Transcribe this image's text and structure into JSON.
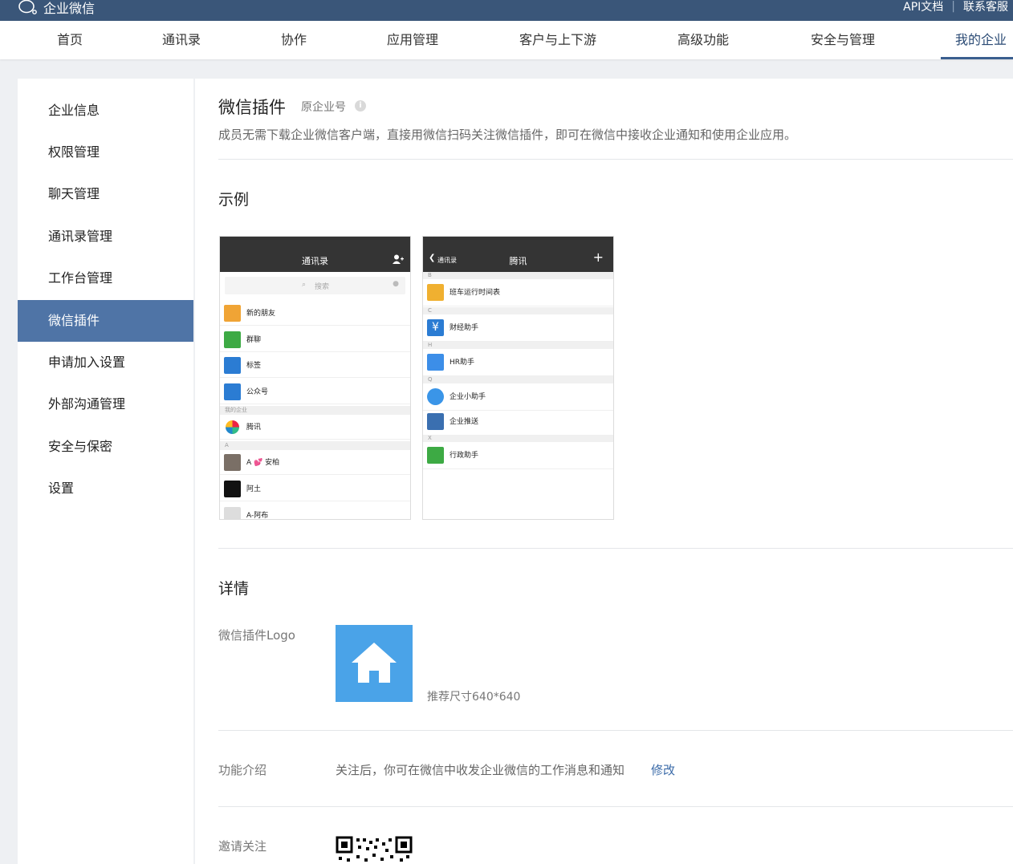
{
  "topbar": {
    "brand": "企业微信",
    "links": [
      "API文档",
      "联系客服"
    ]
  },
  "nav": {
    "items": [
      "首页",
      "通讯录",
      "协作",
      "应用管理",
      "客户与上下游",
      "高级功能",
      "安全与管理",
      "我的企业"
    ],
    "active_index": 7
  },
  "sidebar": {
    "items": [
      "企业信息",
      "权限管理",
      "聊天管理",
      "通讯录管理",
      "工作台管理",
      "微信插件",
      "申请加入设置",
      "外部沟通管理",
      "安全与保密",
      "设置"
    ],
    "active_index": 5
  },
  "page": {
    "title": "微信插件",
    "subtitle": "原企业号",
    "description": "成员无需下载企业微信客户端，直接用微信扫码关注微信插件，即可在微信中接收企业通知和使用企业应用。",
    "example_heading": "示例",
    "details_heading": "详情"
  },
  "phone1": {
    "title": "通讯录",
    "search_placeholder": "搜索",
    "rows": [
      "新的朋友",
      "群聊",
      "标签",
      "公众号"
    ],
    "section_my_company": "我的企业",
    "company": "腾讯",
    "section_a": "A",
    "contacts": [
      "A 💕 安柏",
      "阿土",
      "A-阿布"
    ]
  },
  "phone2": {
    "back_label": "通讯录",
    "title": "腾讯",
    "plus": "+",
    "section_letters": [
      "B",
      "C",
      "H",
      "Q",
      "X"
    ],
    "rows": [
      "班车运行时间表",
      "财经助手",
      "HR助手",
      "企业小助手",
      "企业推送",
      "行政助手"
    ]
  },
  "details": {
    "logo_label": "微信插件Logo",
    "logo_hint": "推荐尺寸640*640",
    "intro_label": "功能介绍",
    "intro_value": "关注后，你可在微信中收发企业微信的工作消息和通知",
    "intro_edit": "修改",
    "invite_label": "邀请关注"
  },
  "colors": {
    "topbar": "#3a5679",
    "sidebar_active": "#4f74a6",
    "link": "#3a6aa8",
    "logo_bg": "#4aa3e8"
  }
}
